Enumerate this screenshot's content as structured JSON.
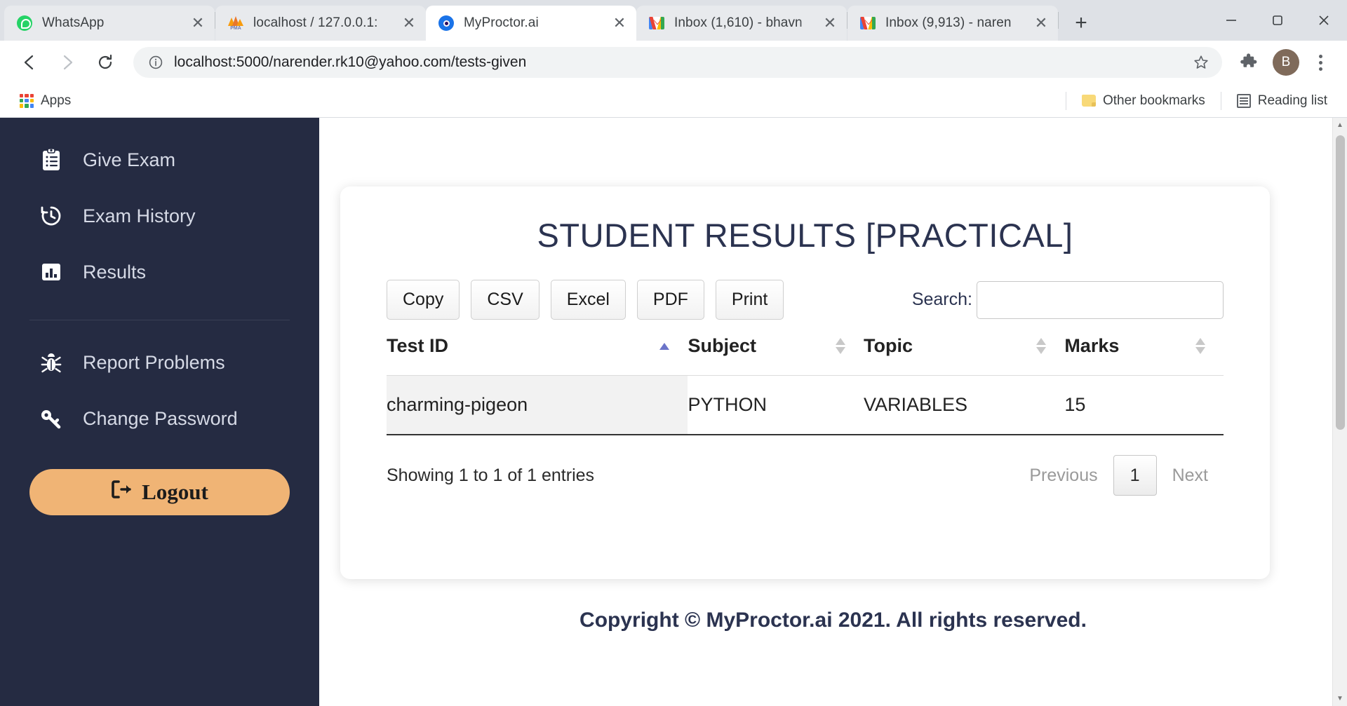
{
  "browser": {
    "tabs": [
      {
        "title": "WhatsApp",
        "favicon": "whatsapp-icon",
        "active": false
      },
      {
        "title": "localhost / 127.0.0.1:",
        "favicon": "phpmyadmin-icon",
        "active": false
      },
      {
        "title": "MyProctor.ai",
        "favicon": "myproctor-icon",
        "active": true
      },
      {
        "title": "Inbox (1,610) - bhavn",
        "favicon": "gmail-icon",
        "active": false
      },
      {
        "title": "Inbox (9,913) - naren",
        "favicon": "gmail-icon",
        "active": false
      }
    ],
    "new_tab_label": "+",
    "close_label": "✕",
    "window_controls": {
      "minimize": "–",
      "maximize": "❐",
      "close": "✕"
    },
    "nav": {
      "back": "←",
      "forward": "→",
      "reload": "⟳"
    },
    "omnibox": {
      "url": "localhost:5000/narender.rk10@yahoo.com/tests-given",
      "info_icon": "ⓘ",
      "star_icon": "☆"
    },
    "avatar_initial": "B",
    "bookmarks": {
      "apps_label": "Apps",
      "other_bookmarks_label": "Other bookmarks",
      "reading_list_label": "Reading list"
    }
  },
  "sidebar": {
    "items": [
      {
        "label": "Give Exam",
        "icon": "clipboard-list-icon"
      },
      {
        "label": "Exam History",
        "icon": "history-clock-icon"
      },
      {
        "label": "Results",
        "icon": "chart-bar-icon"
      }
    ],
    "secondary_items": [
      {
        "label": "Report Problems",
        "icon": "bug-icon"
      },
      {
        "label": "Change Password",
        "icon": "key-icon"
      }
    ],
    "logout": {
      "label": "Logout",
      "icon": "sign-out-icon",
      "color": "#f0b475"
    }
  },
  "main": {
    "page_title": "STUDENT RESULTS [PRACTICAL]",
    "export_buttons": [
      "Copy",
      "CSV",
      "Excel",
      "PDF",
      "Print"
    ],
    "search": {
      "label": "Search:",
      "value": "",
      "placeholder": ""
    },
    "table": {
      "columns": [
        {
          "label": "Test ID",
          "sorted": "asc"
        },
        {
          "label": "Subject",
          "sorted": "none"
        },
        {
          "label": "Topic",
          "sorted": "none"
        },
        {
          "label": "Marks",
          "sorted": "none"
        }
      ],
      "rows": [
        {
          "test_id": "charming-pigeon",
          "subject": "PYTHON",
          "topic": "VARIABLES",
          "marks": "15"
        }
      ]
    },
    "info_text": "Showing 1 to 1 of 1 entries",
    "pagination": {
      "previous": "Previous",
      "current": "1",
      "next": "Next"
    }
  },
  "footer": {
    "copyright": "Copyright © MyProctor.ai 2021. All rights reserved."
  }
}
